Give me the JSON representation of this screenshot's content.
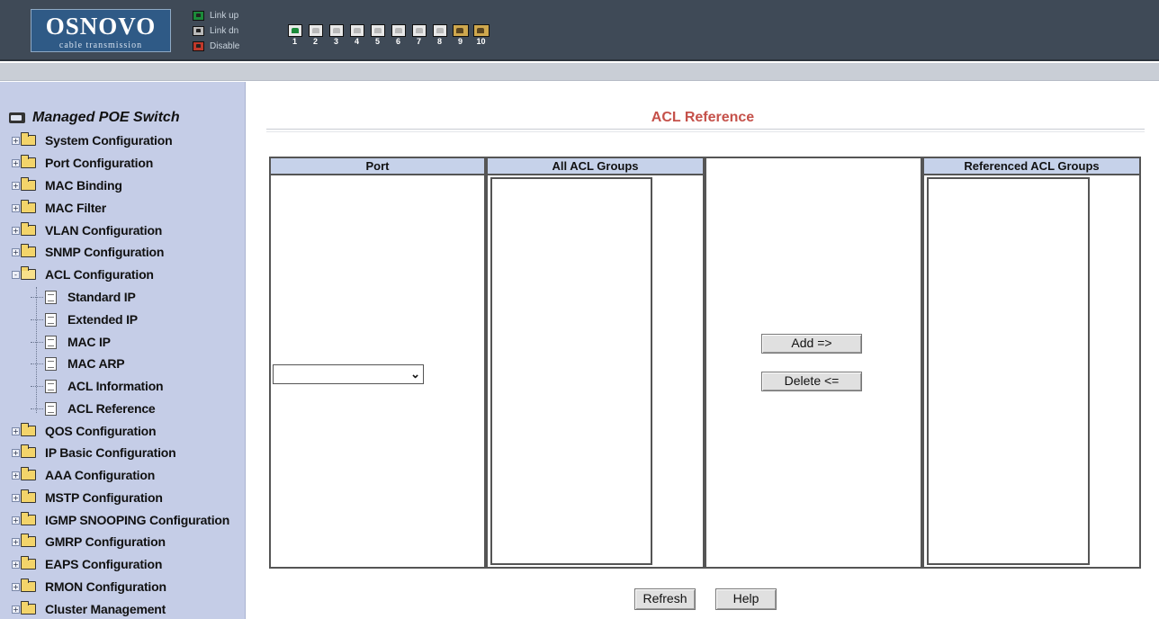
{
  "brand": {
    "logo_main": "OSNOVO",
    "logo_sub": "cable transmission"
  },
  "legend": [
    {
      "label": "Link up",
      "color": "#1c8a3a"
    },
    {
      "label": "Link dn",
      "color": "#b9b9b9"
    },
    {
      "label": "Disable",
      "color": "#c0392b"
    }
  ],
  "ports": [
    {
      "num": "1",
      "state": "up"
    },
    {
      "num": "2",
      "state": "dn"
    },
    {
      "num": "3",
      "state": "dn"
    },
    {
      "num": "4",
      "state": "dn"
    },
    {
      "num": "5",
      "state": "dn"
    },
    {
      "num": "6",
      "state": "dn"
    },
    {
      "num": "7",
      "state": "dn"
    },
    {
      "num": "8",
      "state": "dn"
    },
    {
      "num": "9",
      "state": "dual"
    },
    {
      "num": "10",
      "state": "dual"
    }
  ],
  "sidebar": {
    "root": "Managed POE Switch",
    "items": [
      {
        "label": "System Configuration",
        "expander": "+"
      },
      {
        "label": "Port Configuration",
        "expander": "+"
      },
      {
        "label": "MAC Binding",
        "expander": "+"
      },
      {
        "label": "MAC Filter",
        "expander": "+"
      },
      {
        "label": "VLAN Configuration",
        "expander": "+"
      },
      {
        "label": "SNMP Configuration",
        "expander": "+"
      },
      {
        "label": "ACL Configuration",
        "expander": "-"
      },
      {
        "label": "QOS Configuration",
        "expander": "+"
      },
      {
        "label": "IP Basic Configuration",
        "expander": "+"
      },
      {
        "label": "AAA Configuration",
        "expander": "+"
      },
      {
        "label": "MSTP Configuration",
        "expander": "+"
      },
      {
        "label": "IGMP SNOOPING Configuration",
        "expander": "+"
      },
      {
        "label": "GMRP Configuration",
        "expander": "+"
      },
      {
        "label": "EAPS Configuration",
        "expander": "+"
      },
      {
        "label": "RMON Configuration",
        "expander": "+"
      },
      {
        "label": "Cluster Management",
        "expander": "+"
      }
    ],
    "acl_children": [
      {
        "label": "Standard IP"
      },
      {
        "label": "Extended IP"
      },
      {
        "label": "MAC IP"
      },
      {
        "label": "MAC ARP"
      },
      {
        "label": "ACL Information"
      },
      {
        "label": "ACL Reference"
      }
    ]
  },
  "main": {
    "title": "ACL Reference",
    "columns": {
      "port": "Port",
      "all_groups": "All ACL Groups",
      "referenced_groups": "Referenced ACL Groups"
    },
    "port_select_value": "",
    "buttons": {
      "add": "Add =>",
      "delete": "Delete <=",
      "refresh": "Refresh",
      "help": "Help"
    }
  },
  "colors": {
    "header_bg": "#3f4a57",
    "sidebar_bg": "#c5cde7",
    "title_color": "#c5514a",
    "column_header_bg": "#c6d2ea"
  }
}
